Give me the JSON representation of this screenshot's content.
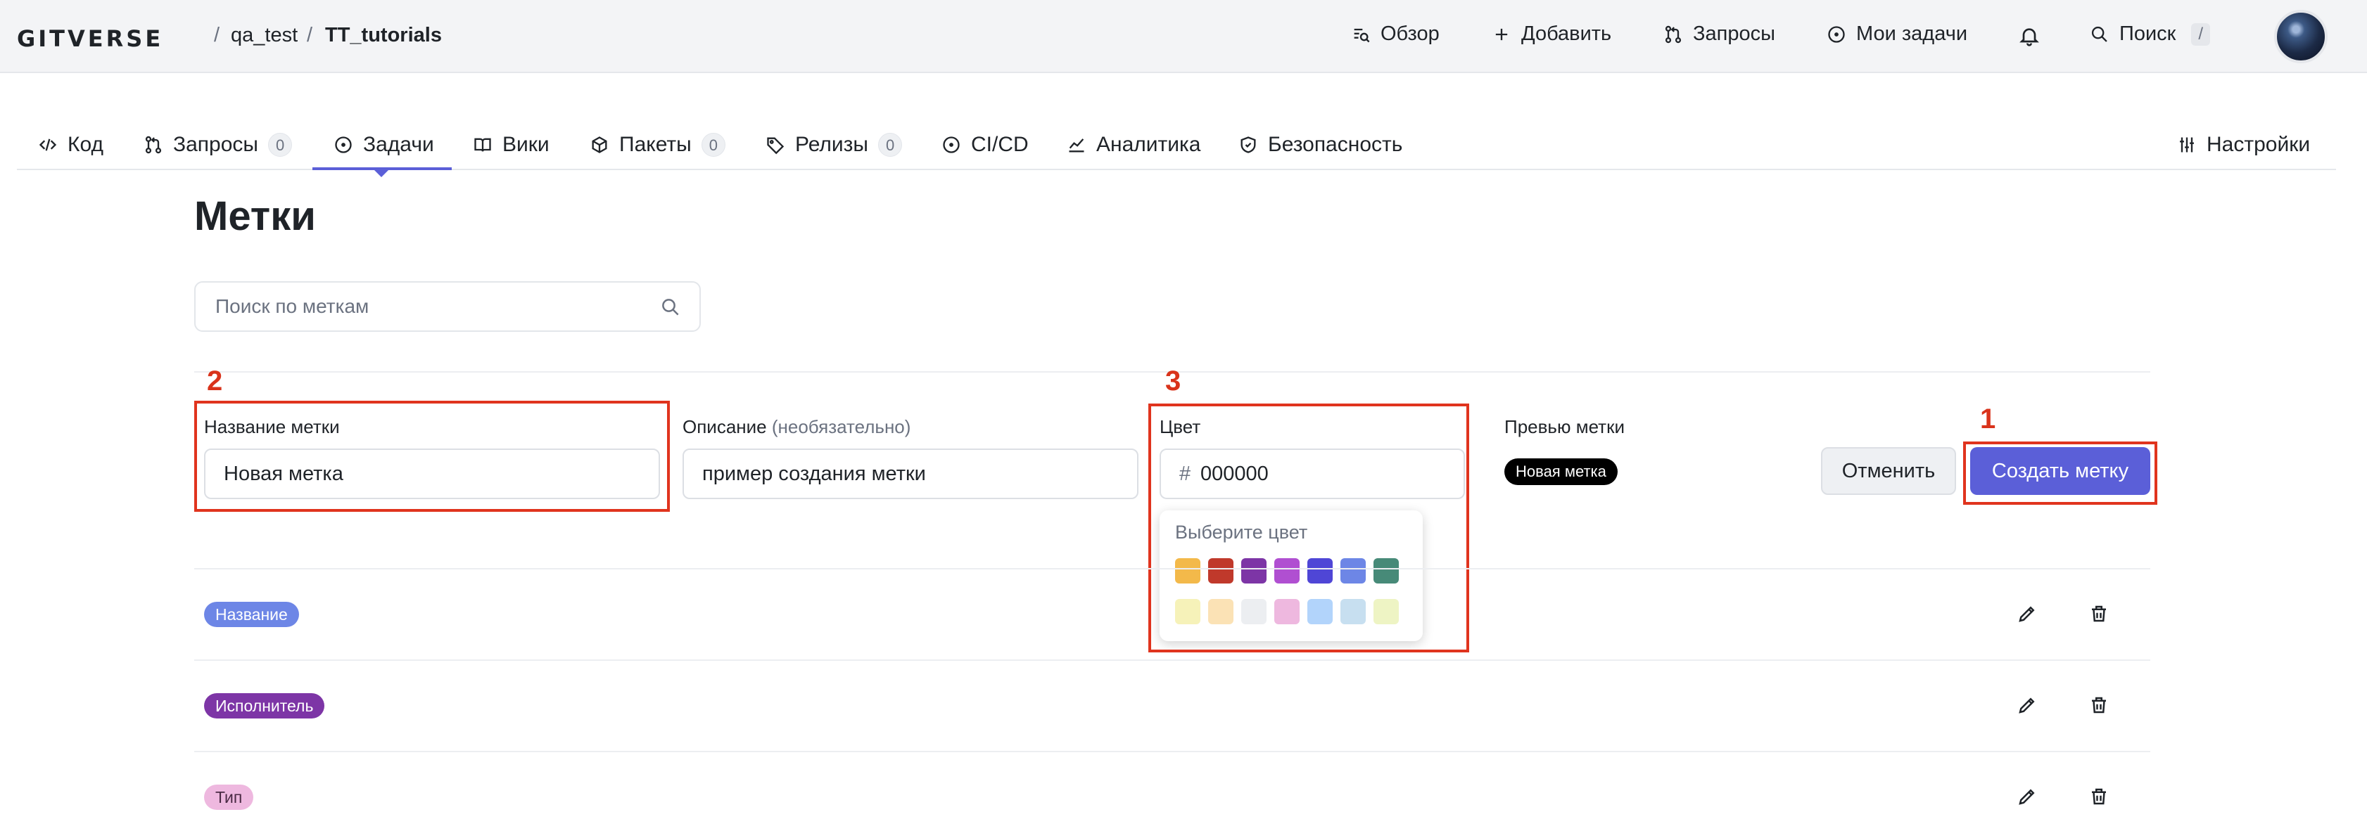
{
  "header": {
    "logo": "GITVERSE",
    "breadcrumb": {
      "owner": "qa_test",
      "separator": "/",
      "repo": "TT_tutorials"
    },
    "nav": {
      "overview": "Обзор",
      "add": "Добавить",
      "requests": "Запросы",
      "my_tasks": "Мои задачи",
      "search": "Поиск",
      "search_shortcut": "/"
    }
  },
  "tabs": [
    {
      "label": "Код"
    },
    {
      "label": "Запросы",
      "count": "0"
    },
    {
      "label": "Задачи"
    },
    {
      "label": "Вики"
    },
    {
      "label": "Пакеты",
      "count": "0"
    },
    {
      "label": "Релизы",
      "count": "0"
    },
    {
      "label": "CI/CD"
    },
    {
      "label": "Аналитика"
    },
    {
      "label": "Безопасность"
    },
    {
      "label": "Настройки"
    }
  ],
  "active_tab": "Задачи",
  "page": {
    "title": "Метки",
    "search_placeholder": "Поиск по меткам"
  },
  "form": {
    "name_label": "Название метки",
    "name_value": "Новая метка",
    "description_label": "Описание",
    "description_hint": "(необязательно)",
    "description_value": "пример создания метки",
    "color_label": "Цвет",
    "color_prefix": "#",
    "color_value": "000000",
    "preview_label": "Превью метки",
    "preview_text": "Новая метка",
    "cancel_button": "Отменить",
    "create_button": "Создать метку"
  },
  "color_picker": {
    "title": "Выберите цвет",
    "row1": [
      "#f3b94a",
      "#c0392b",
      "#7d35a6",
      "#b04fd1",
      "#4f46d6",
      "#6d86e6",
      "#478a78"
    ],
    "row2": [
      "#f6f2b9",
      "#fbe2b5",
      "#eceef1",
      "#eeb8df",
      "#b2d4fb",
      "#c7dff0",
      "#eef4c4"
    ]
  },
  "annotations": [
    "1",
    "2",
    "3"
  ],
  "labels": [
    {
      "name": "Название",
      "color": "#6d86e6"
    },
    {
      "name": "Исполнитель",
      "color": "#7d35a6"
    },
    {
      "name": "Тип",
      "color": "#eeb8df",
      "text_color": "#4a2a44"
    }
  ]
}
